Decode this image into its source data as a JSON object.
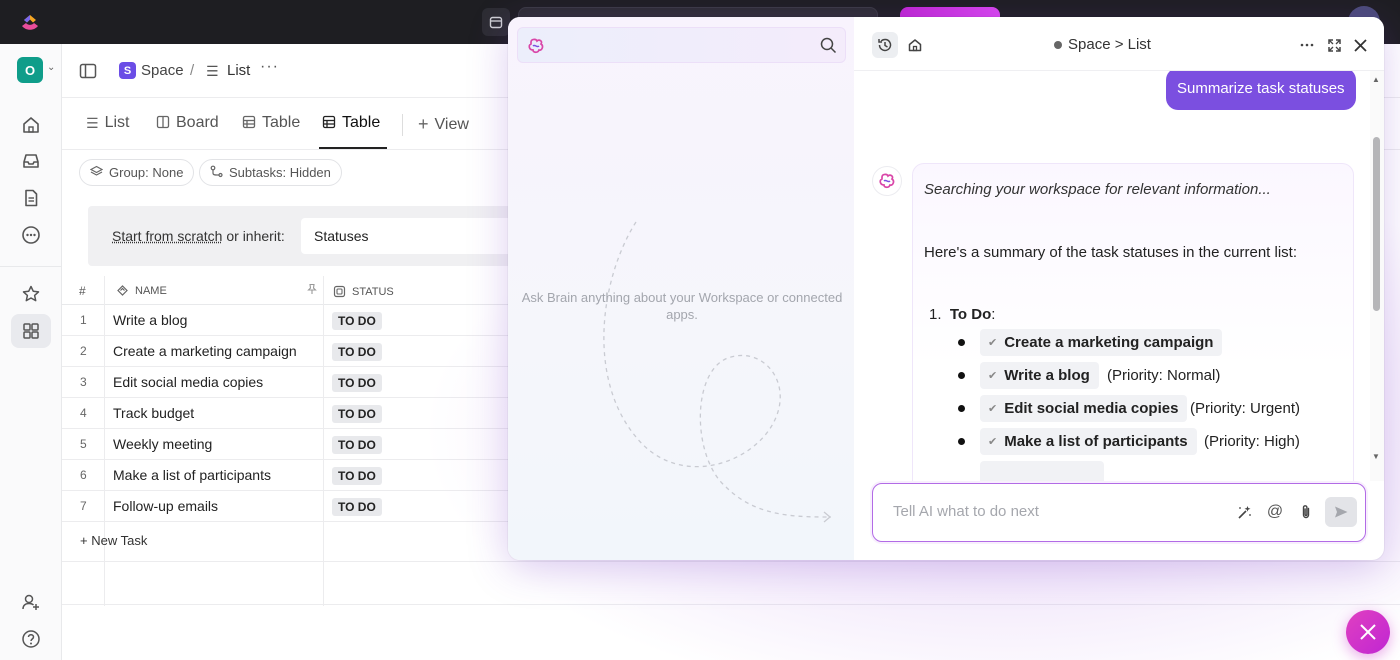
{
  "topbar": {},
  "workspace": {
    "initial": "O"
  },
  "breadcrumb": {
    "space_initial": "S",
    "space": "Space",
    "separator": "/",
    "list": "List",
    "more": "···"
  },
  "tabs": [
    {
      "label": "List"
    },
    {
      "label": "Board"
    },
    {
      "label": "Table"
    },
    {
      "label": "Table"
    },
    {
      "label": "View"
    }
  ],
  "chips": {
    "group": "Group: None",
    "subtasks": "Subtasks: Hidden"
  },
  "inherit": {
    "start_link": "Start from scratch",
    "or_inherit": " or inherit:",
    "select_value": "Statuses"
  },
  "table": {
    "headers": {
      "num": "#",
      "name": "NAME",
      "status": "STATUS"
    },
    "rows": [
      {
        "num": "1",
        "name": "Write a blog",
        "status": "TO DO"
      },
      {
        "num": "2",
        "name": "Create a marketing campaign",
        "status": "TO DO"
      },
      {
        "num": "3",
        "name": "Edit social media copies",
        "status": "TO DO"
      },
      {
        "num": "4",
        "name": "Track budget",
        "status": "TO DO"
      },
      {
        "num": "5",
        "name": "Weekly meeting",
        "status": "TO DO"
      },
      {
        "num": "6",
        "name": "Make a list of participants",
        "status": "TO DO"
      },
      {
        "num": "7",
        "name": "Follow-up emails",
        "status": "TO DO"
      }
    ],
    "new_task": "+ New Task"
  },
  "ai_panel": {
    "left_hint": "Ask Brain anything about your Workspace or connected apps.",
    "title": "Space > List",
    "user_message": "Summarize task statuses",
    "searching": "Searching your workspace for relevant information...",
    "summary": "Here's a summary of the task statuses in the current list:",
    "section_num": "1.",
    "section_title": "To Do",
    "section_colon": ":",
    "tasks": [
      {
        "name": "Create a marketing campaign",
        "priority": ""
      },
      {
        "name": "Write a blog",
        "priority": "(Priority: Normal)"
      },
      {
        "name": "Edit social media copies",
        "priority": "(Priority: Urgent)"
      },
      {
        "name": "Make a list of participants",
        "priority": "(Priority: High)"
      }
    ],
    "compose_placeholder": "Tell AI what to do next"
  },
  "colors": {
    "accent": "#7b4fe0",
    "fab": "#d63ad0",
    "workspace": "#0f9d8a",
    "space": "#6b4de6"
  }
}
